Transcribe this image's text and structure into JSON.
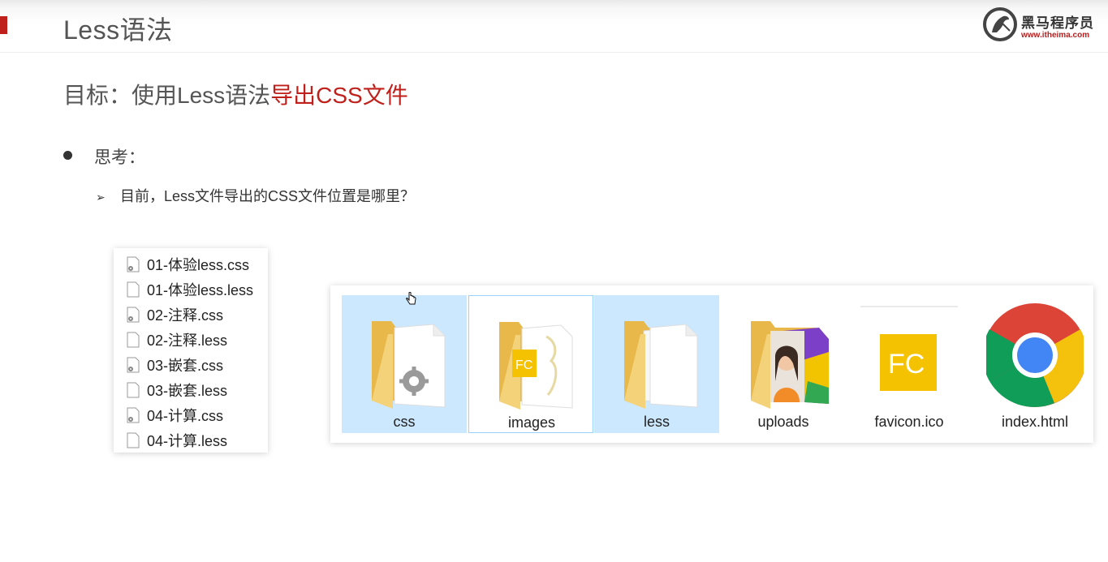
{
  "slide": {
    "title": "Less语法",
    "goal_prefix": "目标：使用Less语法",
    "goal_highlight": "导出CSS文件",
    "bullet": "思考：",
    "sub_bullet": "目前，Less文件导出的CSS文件位置是哪里？",
    "accent_color": "#c0201b"
  },
  "logo": {
    "name": "黑马程序员",
    "url": "www.itheima.com"
  },
  "file_list": [
    {
      "name": "01-体验less.css",
      "icon": "css-file-icon"
    },
    {
      "name": "01-体验less.less",
      "icon": "blank-file-icon"
    },
    {
      "name": "02-注释.css",
      "icon": "css-file-icon"
    },
    {
      "name": "02-注释.less",
      "icon": "blank-file-icon"
    },
    {
      "name": "03-嵌套.css",
      "icon": "css-file-icon"
    },
    {
      "name": "03-嵌套.less",
      "icon": "blank-file-icon"
    },
    {
      "name": "04-计算.css",
      "icon": "css-file-icon"
    },
    {
      "name": "04-计算.less",
      "icon": "blank-file-icon"
    }
  ],
  "explorer_items": [
    {
      "name": "css",
      "icon": "folder-gear-icon",
      "state": "selected"
    },
    {
      "name": "images",
      "icon": "folder-images-icon",
      "state": "hover"
    },
    {
      "name": "less",
      "icon": "folder-docs-icon",
      "state": "selected"
    },
    {
      "name": "uploads",
      "icon": "folder-photo-icon",
      "state": "normal"
    },
    {
      "name": "favicon.ico",
      "icon": "fc-icon",
      "state": "normal"
    },
    {
      "name": "index.html",
      "icon": "chrome-icon",
      "state": "normal"
    }
  ]
}
